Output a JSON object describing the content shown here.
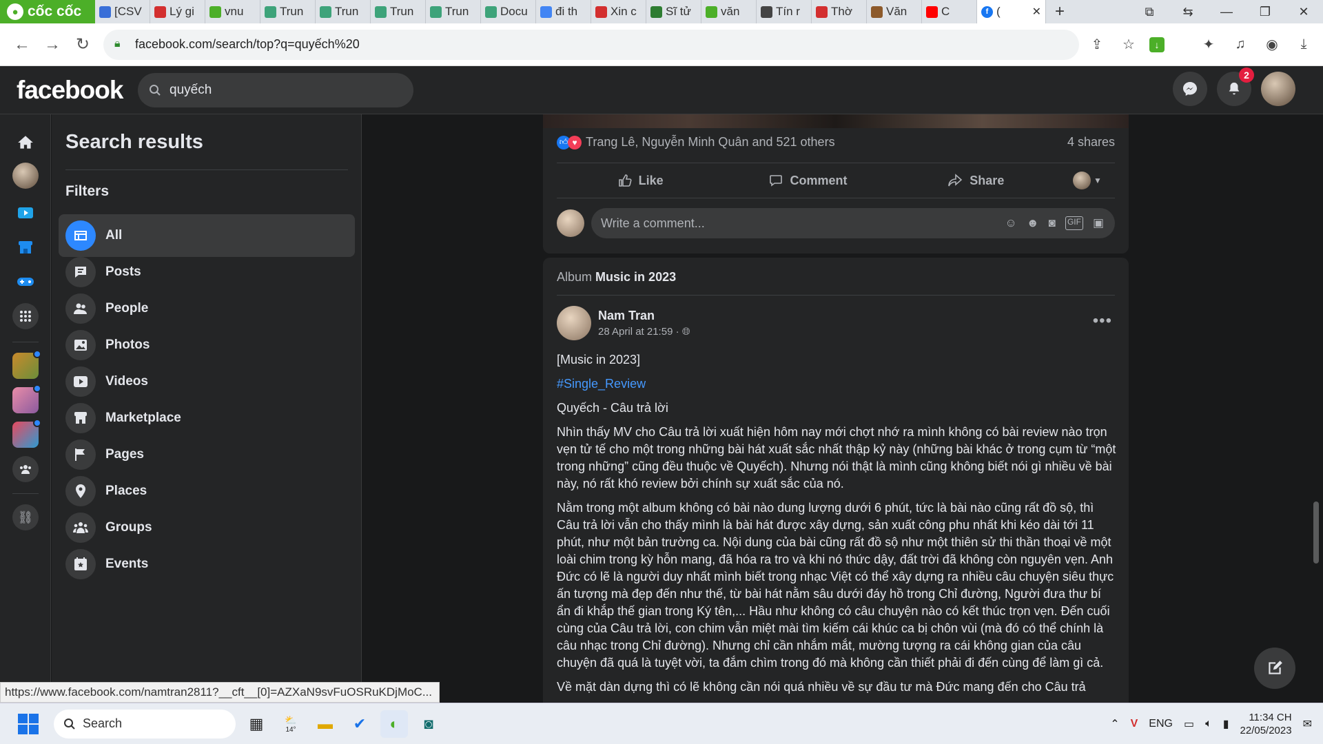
{
  "browser": {
    "brand": "cốc cốc",
    "tabs": [
      {
        "label": "[CSV",
        "icon": "doc",
        "color": "#3a6fd8"
      },
      {
        "label": "Lý gi",
        "icon": "star",
        "color": "#d32f2f"
      },
      {
        "label": "vnu",
        "icon": "leaf",
        "color": "#4caf28"
      },
      {
        "label": "Trun",
        "icon": "globe",
        "color": "#3ea37a"
      },
      {
        "label": "Trun",
        "icon": "globe",
        "color": "#3ea37a"
      },
      {
        "label": "Trun",
        "icon": "globe",
        "color": "#3ea37a"
      },
      {
        "label": "Trun",
        "icon": "globe",
        "color": "#3ea37a"
      },
      {
        "label": "Docu",
        "icon": "globe",
        "color": "#3ea37a"
      },
      {
        "label": "đi th",
        "icon": "google",
        "color": "#4285f4"
      },
      {
        "label": "Xin c",
        "icon": "star",
        "color": "#d32f2f"
      },
      {
        "label": "Sĩ tử",
        "icon": "grid",
        "color": "#2e7d32"
      },
      {
        "label": "văn",
        "icon": "leaf",
        "color": "#4caf28"
      },
      {
        "label": "Tín r",
        "icon": "w",
        "color": "#444444"
      },
      {
        "label": "Thờ",
        "icon": "star",
        "color": "#d32f2f"
      },
      {
        "label": "Văn",
        "icon": "person",
        "color": "#8d5a2b"
      },
      {
        "label": "C",
        "icon": "youtube",
        "color": "#ff0000"
      }
    ],
    "active_tab_label": "(",
    "url": "facebook.com/search/top?q=quyếch%20"
  },
  "fb": {
    "logo": "facebook",
    "search_value": "quyếch",
    "notifications_count": "2"
  },
  "filters": {
    "title": "Search results",
    "label": "Filters",
    "items": [
      {
        "label": "All",
        "icon": "all-icon"
      },
      {
        "label": "Posts",
        "icon": "posts-icon"
      },
      {
        "label": "People",
        "icon": "people-icon"
      },
      {
        "label": "Photos",
        "icon": "photos-icon"
      },
      {
        "label": "Videos",
        "icon": "videos-icon"
      },
      {
        "label": "Marketplace",
        "icon": "marketplace-icon"
      },
      {
        "label": "Pages",
        "icon": "pages-icon"
      },
      {
        "label": "Places",
        "icon": "places-icon"
      },
      {
        "label": "Groups",
        "icon": "groups-icon"
      },
      {
        "label": "Events",
        "icon": "events-icon"
      }
    ]
  },
  "post1": {
    "reactions_text": "Trang Lê, Nguyễn Minh Quân and 521 others",
    "shares": "4 shares",
    "like": "Like",
    "comment": "Comment",
    "share": "Share",
    "comment_placeholder": "Write a comment..."
  },
  "post2": {
    "album_prefix": "Album",
    "album_name": "Music in 2023",
    "author": "Nam Tran",
    "meta": "28 April at 21:59 ·",
    "line1": "[Music in 2023]",
    "hashtag": "#Single_Review",
    "line3": "Quyếch - Câu trả lời",
    "para1": "Nhìn thấy MV cho Câu trả lời xuất hiện hôm nay mới chợt nhớ ra mình không có bài review nào trọn vẹn tử tế cho một trong những bài hát xuất sắc nhất thập kỷ này (những bài khác ở trong cụm từ “một trong những” cũng đều thuộc về Quyếch). Nhưng nói thật là mình cũng không biết nói gì nhiều về bài này, nó rất khó review bởi chính sự xuất sắc của nó.",
    "para2": "Nằm trong một album không có bài nào dung lượng dưới 6 phút, tức là bài nào cũng rất đồ sộ, thì Câu trả lời vẫn cho thấy mình là bài hát được xây dựng, sản xuất công phu nhất khi kéo dài tới 11 phút, như một bản trường ca. Nội dung của bài cũng rất đồ sộ như một thiên sử thi thần thoại về một loài chim trong kỳ hỗn mang, đã hóa ra tro và khi nó thức dậy, đất trời đã không còn nguyên vẹn. Anh Đức có lẽ là người duy nhất mình biết trong nhạc Việt có thể xây dựng ra nhiều câu chuyện siêu thực ấn tượng mà đẹp đến như thế, từ bài hát nằm sâu dưới đáy hồ trong Chỉ đường, Người đưa thư bí ẩn đi khắp thế gian trong Ký tên,... Hầu như không có câu chuyện nào có kết thúc trọn vẹn. Đến cuối cùng của Câu trả lời, con chim vẫn miệt mài tìm kiếm cái khúc ca bị chôn vùi (mà đó có thể chính là câu nhạc trong Chỉ đường). Nhưng chỉ cần nhắm mắt, mường tượng ra cái không gian của câu chuyện đã quá là tuyệt vời, ta đắm chìm trong đó mà không cần thiết phải đi đến cùng để làm gì cả.",
    "para3": "Về mặt dàn dựng thì có lẽ không cần nói quá nhiều về sự đầu tư mà Đức mang đến cho Câu trả"
  },
  "status_url": "https://www.facebook.com/namtran2811?__cft__[0]=AZXaN9svFuOSRuKDjMoC...",
  "taskbar": {
    "search_label": "Search",
    "language": "ENG",
    "time": "11:34 CH",
    "date": "22/05/2023",
    "weather": "14°"
  }
}
